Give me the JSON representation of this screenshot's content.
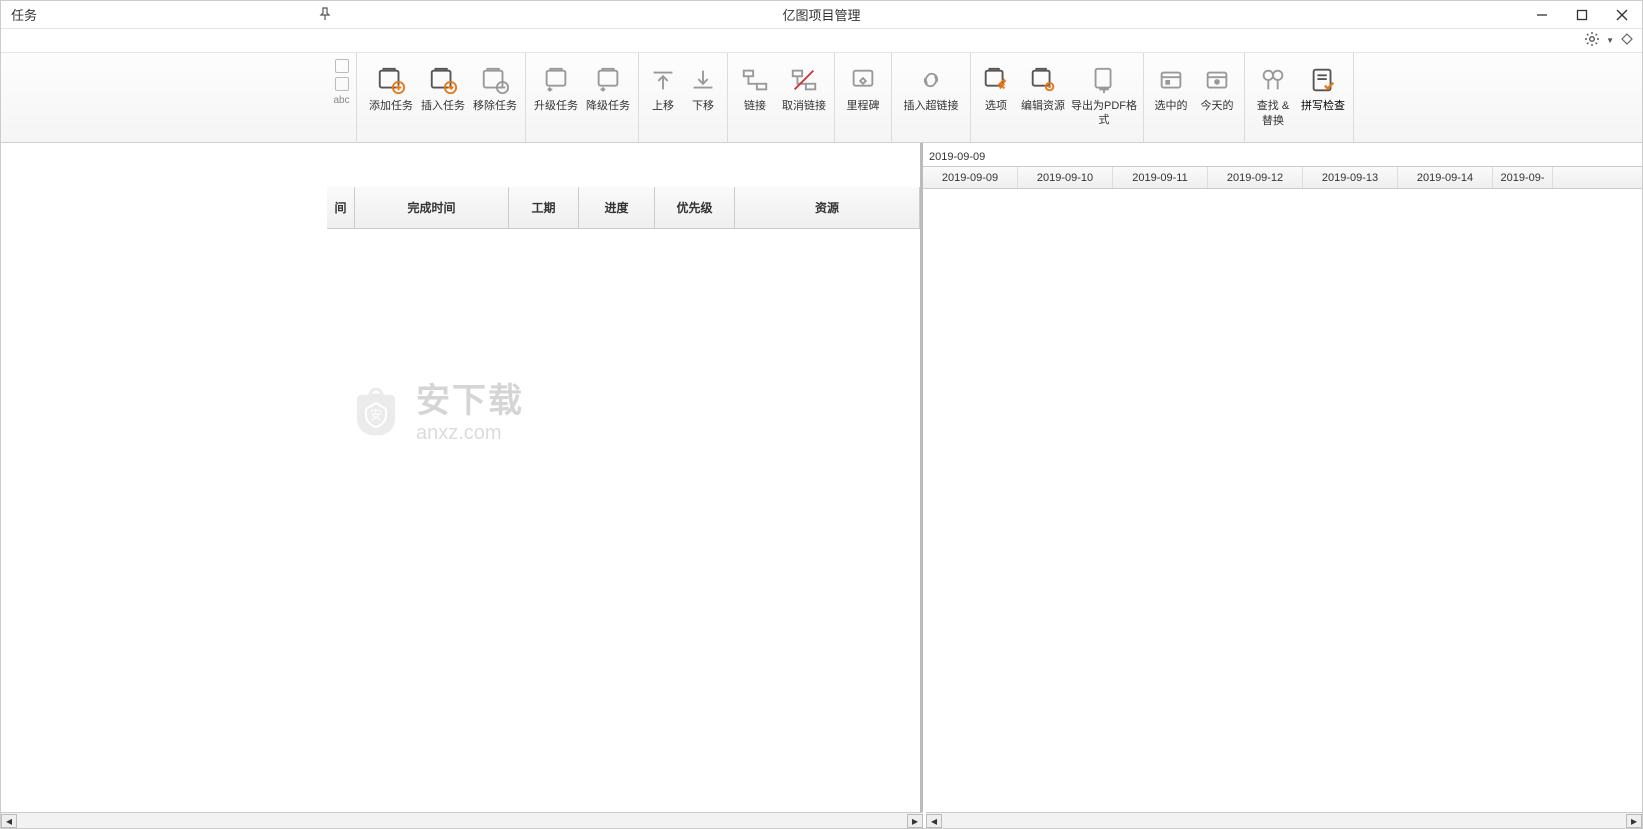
{
  "titlebar": {
    "panel_title": "任务",
    "app_title": "亿图项目管理"
  },
  "stub": {
    "abc": "abc"
  },
  "ribbon": {
    "add_task": "添加任务",
    "insert_task": "插入任务",
    "remove_task": "移除任务",
    "upgrade_task": "升级任务",
    "downgrade_task": "降级任务",
    "move_up": "上移",
    "move_down": "下移",
    "link": "链接",
    "unlink": "取消链接",
    "milestone": "里程碑",
    "insert_hyperlink": "插入超链接",
    "options": "选项",
    "edit_resources": "编辑资源",
    "export_pdf": "导出为PDF格式",
    "selected": "选中的",
    "today": "今天的",
    "find_replace_l1": "查找 &",
    "find_replace_l2": "替换",
    "spell_check": "拼写检查"
  },
  "grid": {
    "col_time_partial": "间",
    "col_finish": "完成时间",
    "col_duration": "工期",
    "col_progress": "进度",
    "col_priority": "优先级",
    "col_resources": "资源"
  },
  "gantt": {
    "week_start": "2019-09-09",
    "dates": [
      "2019-09-09",
      "2019-09-10",
      "2019-09-11",
      "2019-09-12",
      "2019-09-13",
      "2019-09-14",
      "2019-09-"
    ]
  },
  "watermark": {
    "line1": "安下载",
    "line2": "anxz.com"
  }
}
